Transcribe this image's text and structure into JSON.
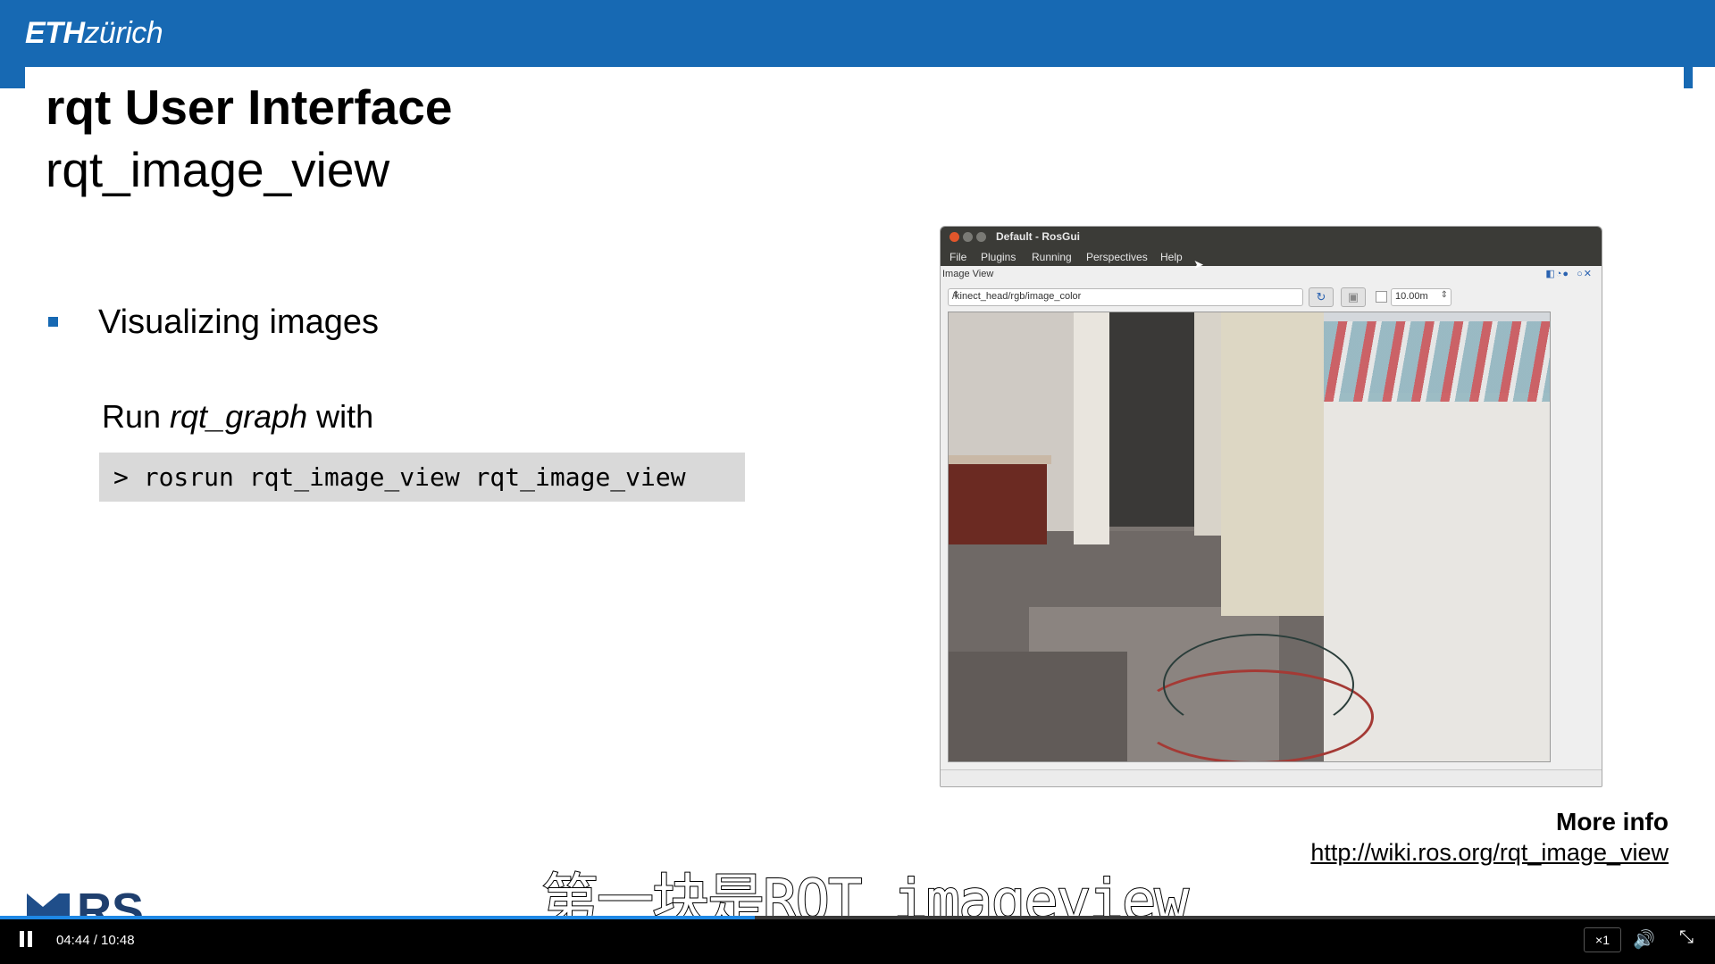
{
  "header": {
    "logo_bold": "ETH",
    "logo_rest": "zürich",
    "color": "#1769b3"
  },
  "slide": {
    "title": "rqt User Interface",
    "subtitle": "rqt_image_view",
    "bullet": "Visualizing images",
    "run_prefix": "Run ",
    "run_command_name": "rqt_graph",
    "run_suffix": " with",
    "code": "> rosrun rqt_image_view rqt_image_view",
    "more_info_label": "More info",
    "more_info_link": "http://wiki.ros.org/rqt_image_view"
  },
  "rosgui": {
    "window_title": "Default - RosGui",
    "menu": [
      "File",
      "Plugins",
      "Running",
      "Perspectives",
      "Help"
    ],
    "panel_label": "Image View",
    "panel_icons": "D C ? - O x",
    "topic": "/kinect_head/rgb/image_color",
    "timeout": "10.00m"
  },
  "caption": "第一块是RQT imageview",
  "player": {
    "time": "04:44 / 10:48",
    "progress": 0.44,
    "speed": "×1"
  }
}
